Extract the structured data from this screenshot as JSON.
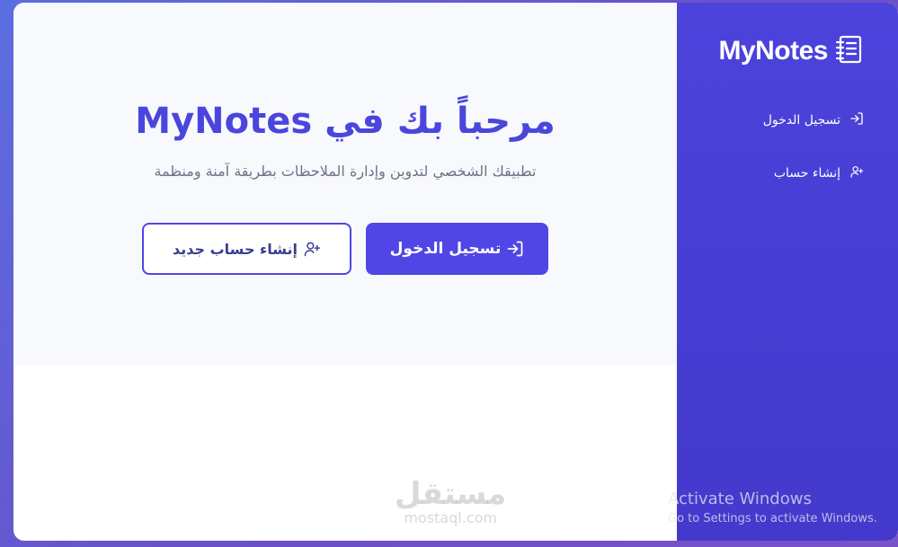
{
  "hero": {
    "title": "مرحباً بك في MyNotes",
    "subtitle": "تطبيقك الشخصي لتدوين وإدارة الملاحظات بطريقة آمنة ومنظمة",
    "login_button": "تسجيل الدخول",
    "register_button": "إنشاء حساب جديد"
  },
  "sidebar": {
    "brand": "MyNotes",
    "items": [
      {
        "label": "تسجيل الدخول",
        "icon": "login-icon"
      },
      {
        "label": "إنشاء حساب",
        "icon": "user-plus-icon"
      }
    ]
  },
  "watermark": {
    "arabic": "مستقل",
    "latin": "mostaql.com"
  },
  "activation": {
    "title": "Activate Windows",
    "subtitle": "Go to Settings to activate Windows."
  },
  "colors": {
    "accent": "#4f46e5",
    "title": "#4a46dd",
    "sidebar": "#4b43db"
  }
}
